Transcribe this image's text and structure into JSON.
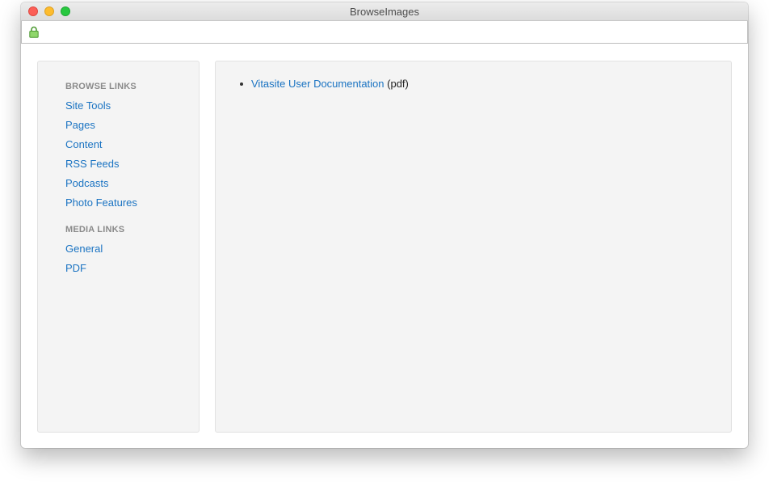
{
  "window": {
    "title": "BrowseImages"
  },
  "addressbar": {
    "icon": "lock-icon"
  },
  "sidebar": {
    "browse_heading": "BROWSE LINKS",
    "browse_items": [
      {
        "label": "Site Tools"
      },
      {
        "label": "Pages"
      },
      {
        "label": "Content"
      },
      {
        "label": "RSS Feeds"
      },
      {
        "label": "Podcasts"
      },
      {
        "label": "Photo Features"
      }
    ],
    "media_heading": "MEDIA LINKS",
    "media_items": [
      {
        "label": "General"
      },
      {
        "label": "PDF"
      }
    ]
  },
  "main": {
    "documents": [
      {
        "link": "Vitasite User Documentation",
        "suffix": "(pdf)"
      }
    ]
  },
  "colors": {
    "link": "#1a73c2",
    "heading": "#8a8a8a",
    "panel_bg": "#f4f4f4",
    "lock": "#6cc04a"
  }
}
